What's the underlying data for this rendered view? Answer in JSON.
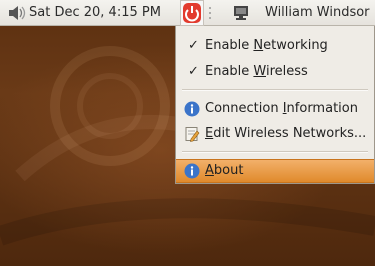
{
  "panel": {
    "volume_icon": "speaker-icon",
    "clock": "Sat Dec 20,  4:15 PM",
    "network_icon": "network-manager-icon",
    "power_icon": "power-icon",
    "user_name": "William Windsor"
  },
  "menu": {
    "items": [
      {
        "pre": "Enable ",
        "key": "N",
        "post": "etworking",
        "checked": true,
        "check": "✓"
      },
      {
        "pre": "Enable ",
        "key": "W",
        "post": "ireless",
        "checked": true,
        "check": "✓"
      },
      {
        "pre": "Connection ",
        "key": "I",
        "post": "nformation",
        "icon": "info-icon"
      },
      {
        "pre": "",
        "key": "E",
        "post": "dit Wireless Networks...",
        "icon": "edit-icon"
      },
      {
        "pre": "",
        "key": "A",
        "post": "bout",
        "icon": "info-icon",
        "selected": true
      }
    ]
  },
  "colors": {
    "accent": "#e08a2c",
    "desktop": "#5b2f10",
    "power": "#e23b2e",
    "info": "#3b74c9"
  }
}
